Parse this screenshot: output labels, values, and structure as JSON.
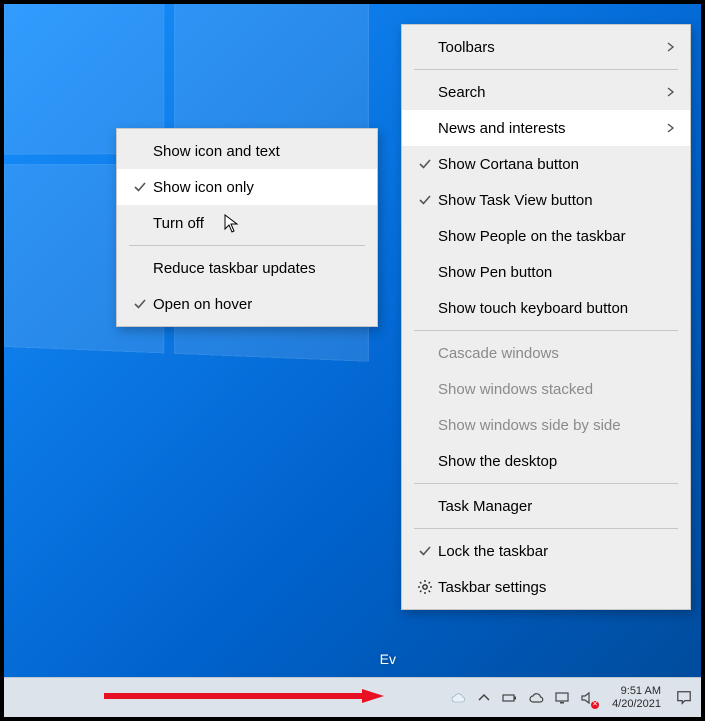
{
  "desktop": {
    "ev_fragment": "Ev"
  },
  "taskbar": {
    "clock_time": "9:51 AM",
    "clock_date": "4/20/2021"
  },
  "main_menu": {
    "toolbars": "Toolbars",
    "search": "Search",
    "news": "News and interests",
    "cortana": "Show Cortana button",
    "taskview": "Show Task View button",
    "people": "Show People on the taskbar",
    "pen": "Show Pen button",
    "touch_kbd": "Show touch keyboard button",
    "cascade": "Cascade windows",
    "stacked": "Show windows stacked",
    "sidebyside": "Show windows side by side",
    "show_desktop": "Show the desktop",
    "task_manager": "Task Manager",
    "lock": "Lock the taskbar",
    "settings": "Taskbar settings"
  },
  "sub_menu": {
    "icon_text": "Show icon and text",
    "icon_only": "Show icon only",
    "turn_off": "Turn off",
    "reduce": "Reduce taskbar updates",
    "open_hover": "Open on hover"
  }
}
